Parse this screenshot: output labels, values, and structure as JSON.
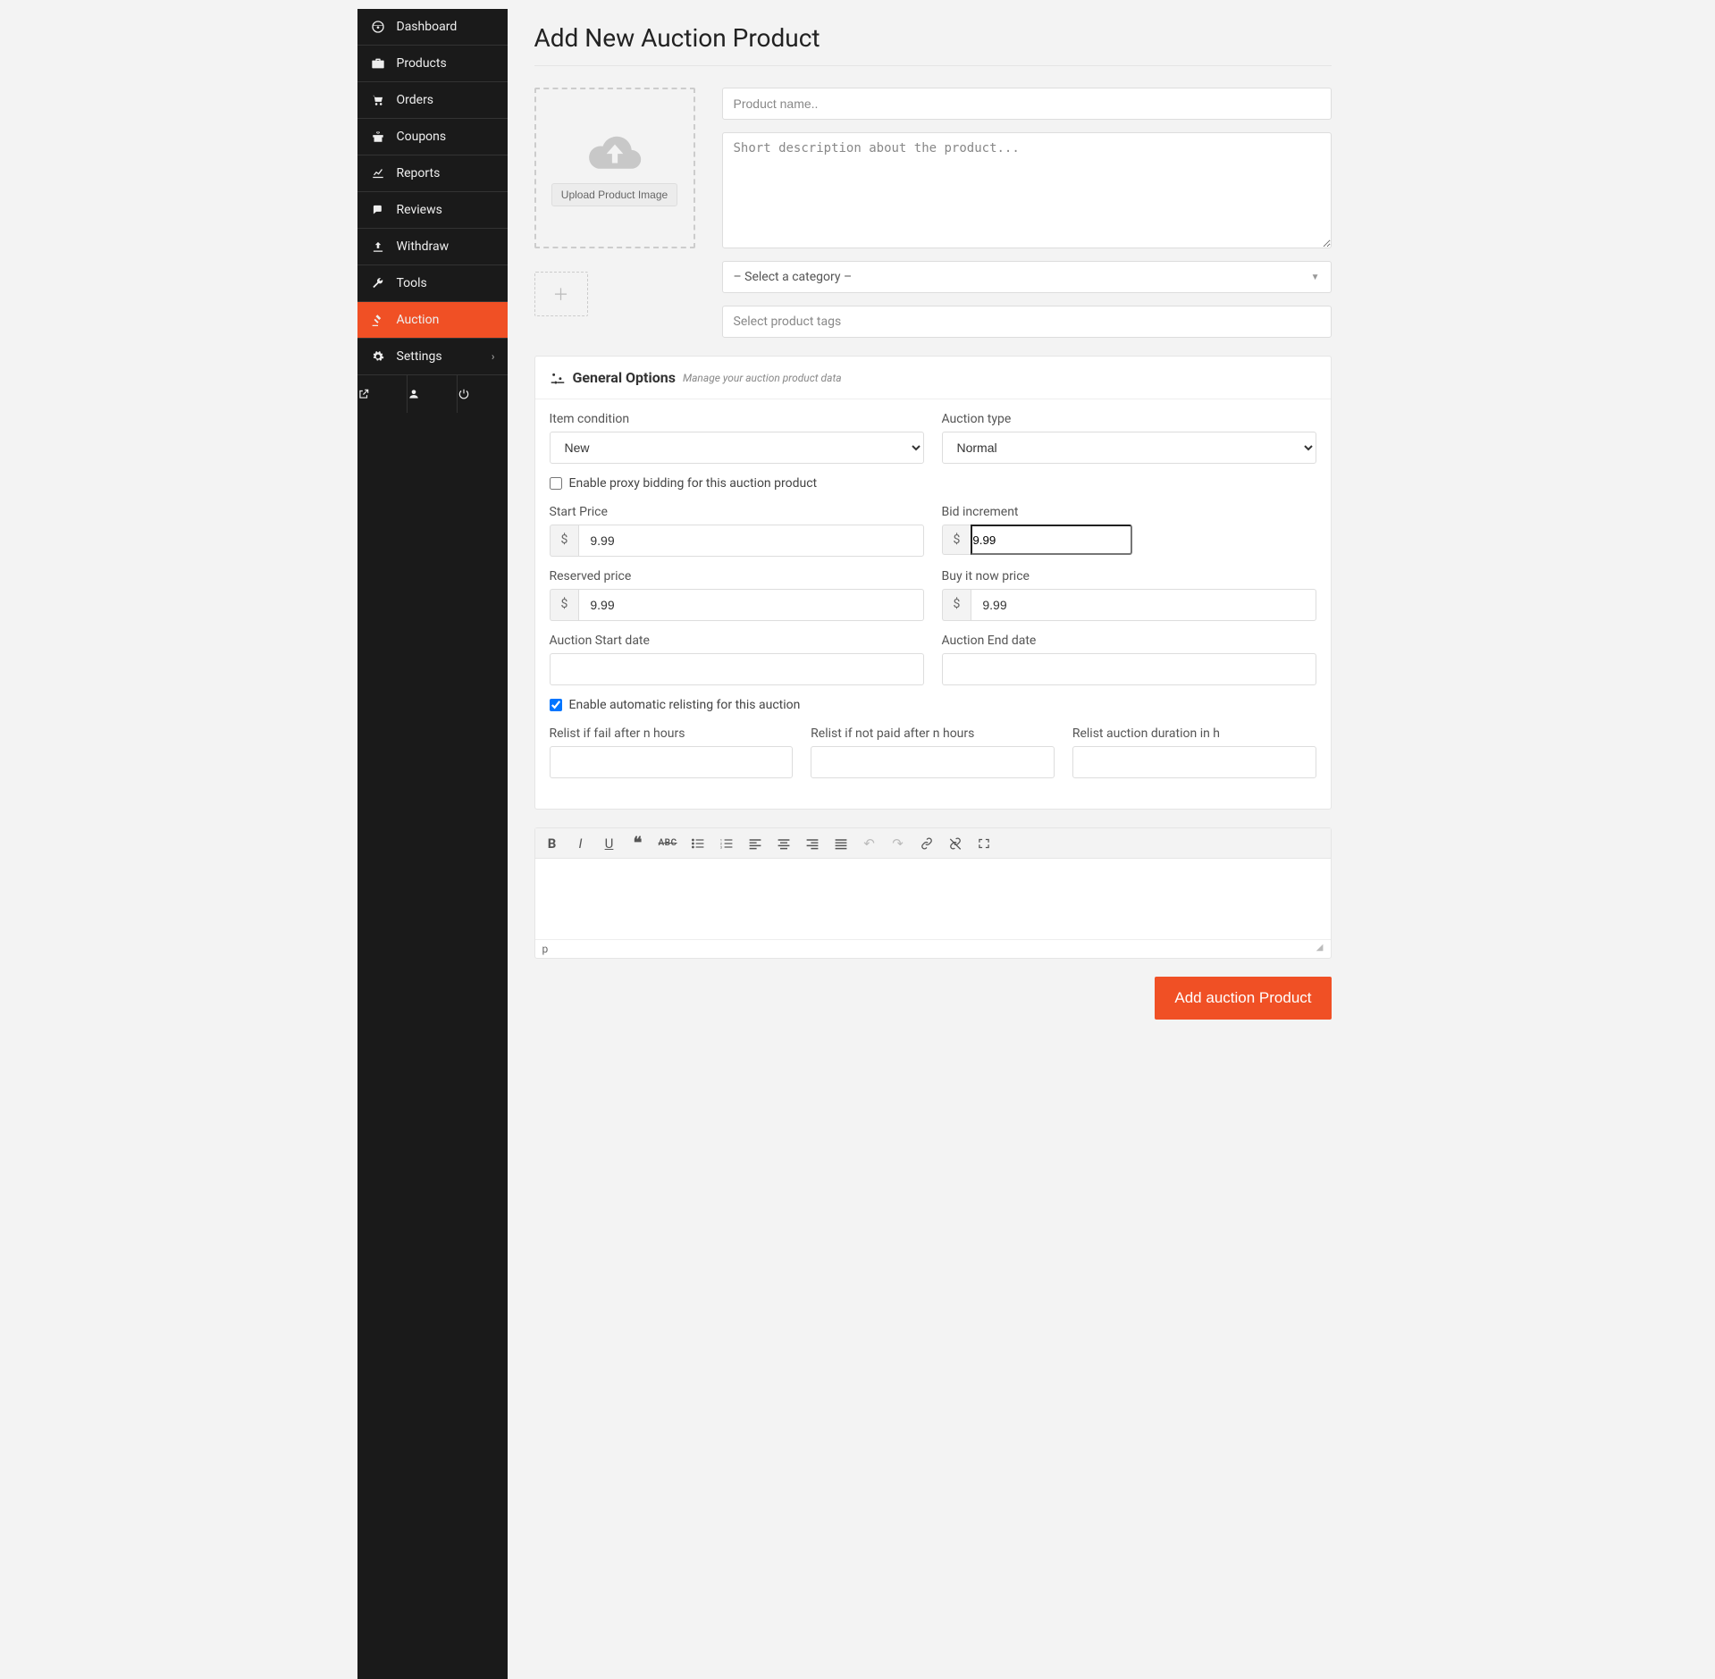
{
  "sidebar": {
    "items": [
      {
        "label": "Dashboard",
        "icon": "dashboard-icon"
      },
      {
        "label": "Products",
        "icon": "briefcase-icon"
      },
      {
        "label": "Orders",
        "icon": "cart-icon"
      },
      {
        "label": "Coupons",
        "icon": "gift-icon"
      },
      {
        "label": "Reports",
        "icon": "chart-icon"
      },
      {
        "label": "Reviews",
        "icon": "comments-icon"
      },
      {
        "label": "Withdraw",
        "icon": "upload-icon"
      },
      {
        "label": "Tools",
        "icon": "wrench-icon"
      },
      {
        "label": "Auction",
        "icon": "gavel-icon",
        "active": true
      },
      {
        "label": "Settings",
        "icon": "cog-icon",
        "has_submenu": true
      }
    ]
  },
  "page": {
    "title": "Add New Auction Product"
  },
  "upload": {
    "button_label": "Upload Product Image"
  },
  "product": {
    "name_placeholder": "Product name..",
    "desc_placeholder": "Short description about the product...",
    "category_placeholder": "– Select a category –",
    "tags_placeholder": "Select product tags"
  },
  "general": {
    "title": "General Options",
    "subtitle": "Manage your auction product data",
    "item_condition": {
      "label": "Item condition",
      "value": "New"
    },
    "auction_type": {
      "label": "Auction type",
      "value": "Normal"
    },
    "proxy_bidding": {
      "label": "Enable proxy bidding for this auction product",
      "checked": false
    },
    "start_price": {
      "label": "Start Price",
      "currency": "$",
      "value": "9.99"
    },
    "bid_increment": {
      "label": "Bid increment",
      "currency": "$",
      "value": "9.99"
    },
    "reserved_price": {
      "label": "Reserved price",
      "currency": "$",
      "value": "9.99"
    },
    "buy_now": {
      "label": "Buy it now price",
      "currency": "$",
      "value": "9.99"
    },
    "start_date": {
      "label": "Auction Start date",
      "value": ""
    },
    "end_date": {
      "label": "Auction End date",
      "value": ""
    },
    "auto_relist": {
      "label": "Enable automatic relisting for this auction",
      "checked": true
    },
    "relist_fail": {
      "label": "Relist if fail after n hours",
      "value": ""
    },
    "relist_not_paid": {
      "label": "Relist if not paid after n hours",
      "value": ""
    },
    "relist_duration": {
      "label": "Relist auction duration in h",
      "value": ""
    }
  },
  "editor": {
    "status_path": "p"
  },
  "submit": {
    "label": "Add auction Product"
  }
}
